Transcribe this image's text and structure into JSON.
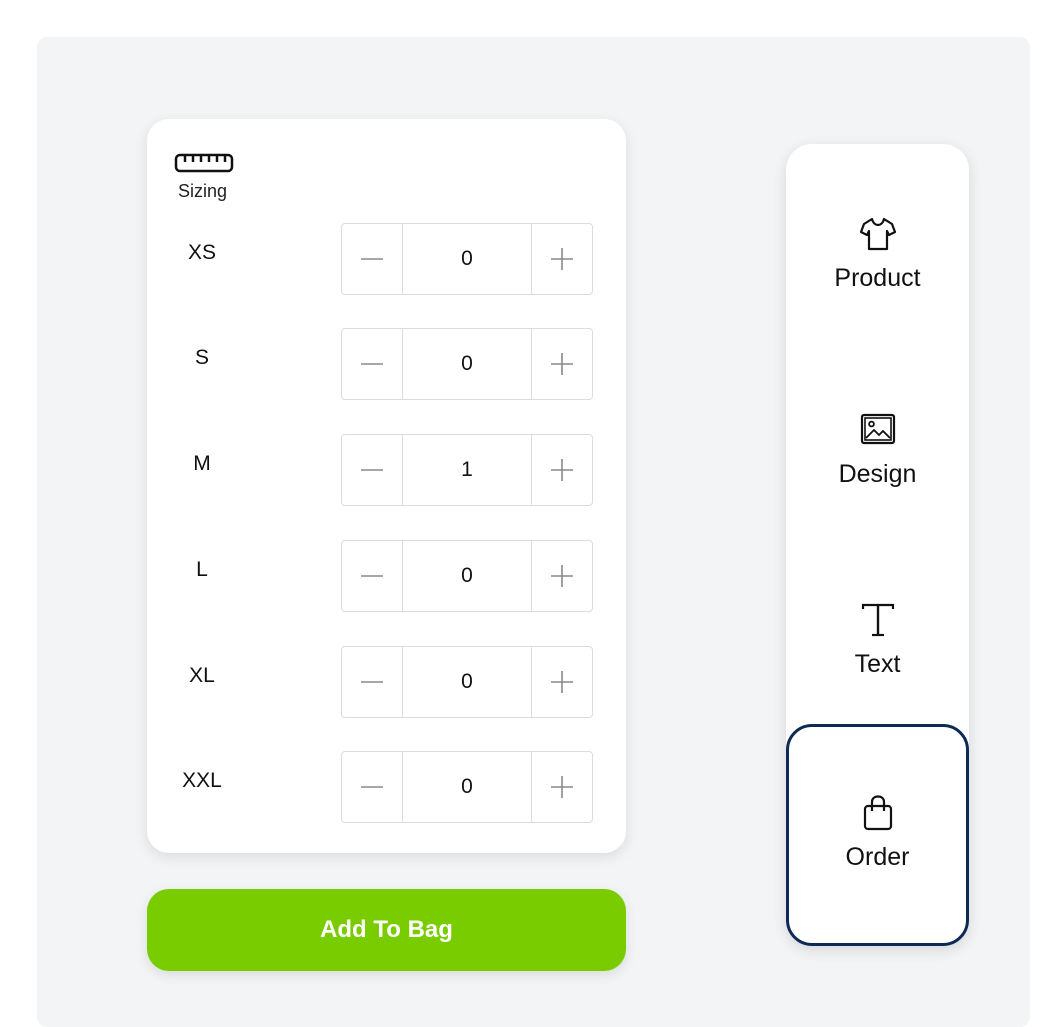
{
  "sizing": {
    "label": "Sizing",
    "icon": "ruler-icon",
    "rows": [
      {
        "size": "XS",
        "qty": "0"
      },
      {
        "size": "S",
        "qty": "0"
      },
      {
        "size": "M",
        "qty": "1"
      },
      {
        "size": "L",
        "qty": "0"
      },
      {
        "size": "XL",
        "qty": "0"
      },
      {
        "size": "XXL",
        "qty": "0"
      }
    ]
  },
  "add_button": {
    "label": "Add To Bag",
    "color": "#78cc00"
  },
  "nav": {
    "items": [
      {
        "label": "Product",
        "icon": "tshirt-icon"
      },
      {
        "label": "Design",
        "icon": "image-icon"
      },
      {
        "label": "Text",
        "icon": "text-icon"
      },
      {
        "label": "Order",
        "icon": "shopping-bag-icon"
      }
    ],
    "active": "Order",
    "active_border_color": "#0d2a57"
  }
}
